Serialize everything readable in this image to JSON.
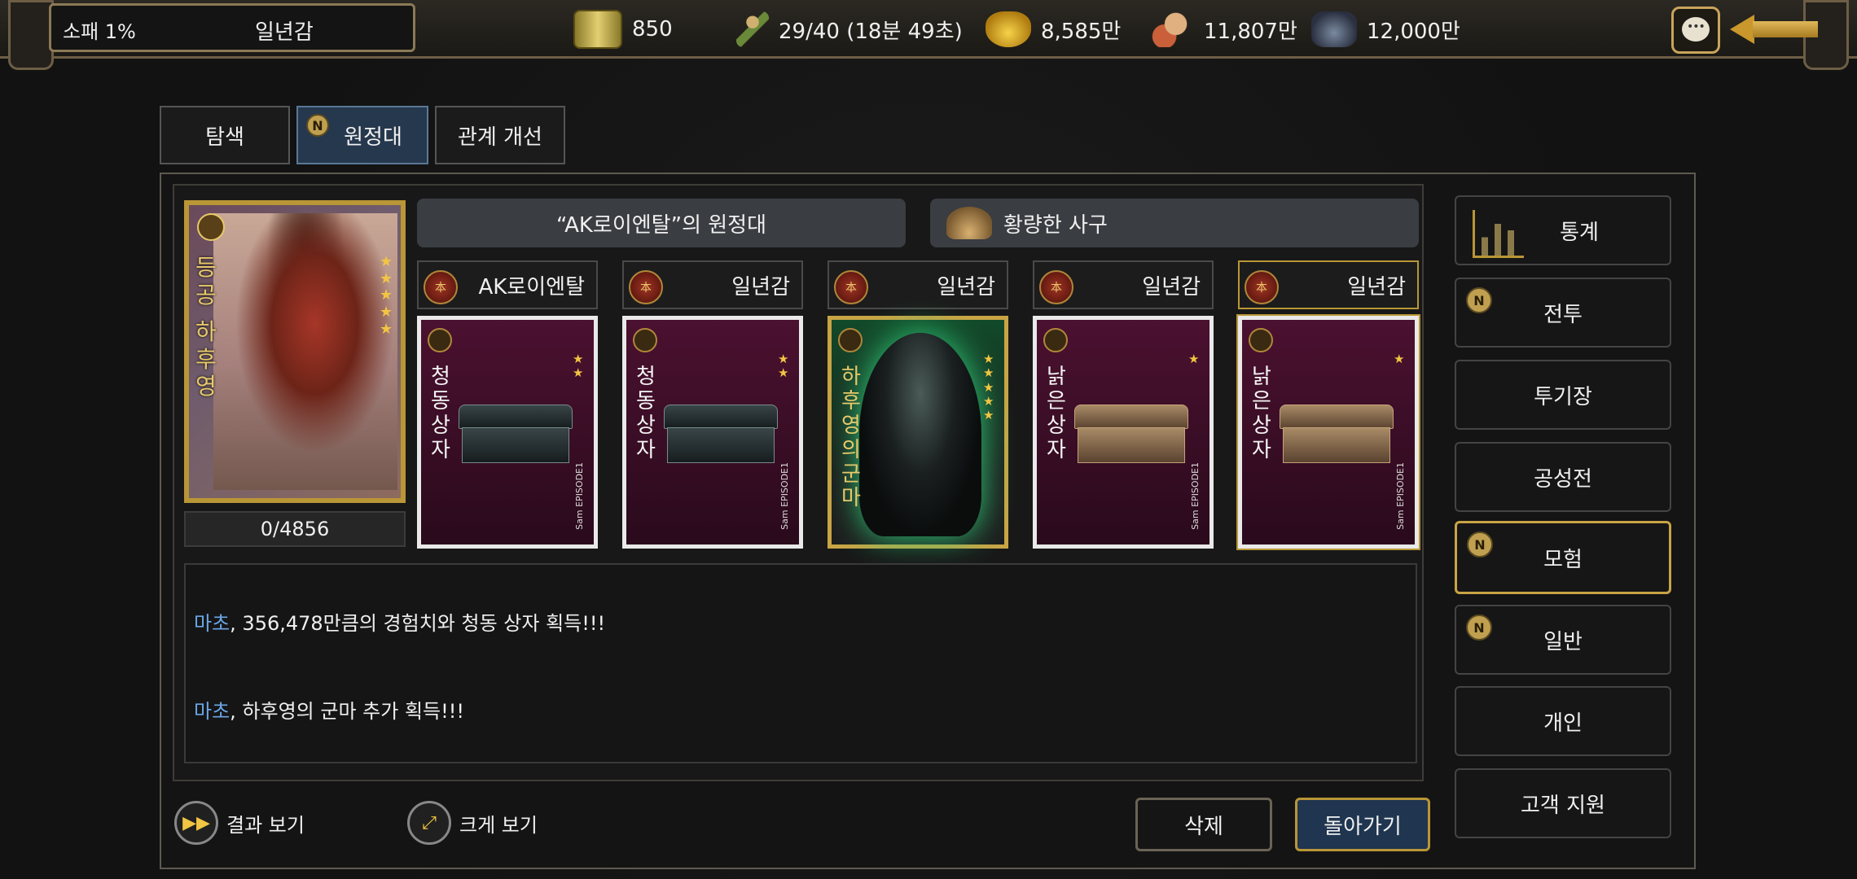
{
  "topbar": {
    "player_label": "소패 1%",
    "player_name": "일년감",
    "resources": [
      {
        "icon": "scroll-icon",
        "value": "850"
      },
      {
        "icon": "runner-stamina-icon",
        "value": "29/40 (18분 49초)"
      },
      {
        "icon": "gold-ingot-icon",
        "value": "8,585만"
      },
      {
        "icon": "food-meat-icon",
        "value": "11,807만"
      },
      {
        "icon": "iron-ore-icon",
        "value": "12,000만"
      }
    ]
  },
  "tabs": [
    {
      "label": "탐색",
      "badge": ""
    },
    {
      "label": "원정대",
      "badge": "N"
    },
    {
      "label": "관계 개선",
      "badge": ""
    }
  ],
  "hero": {
    "vertical_title": "등공",
    "vertical_name": "하후영",
    "stars": 5,
    "count": "0/4856"
  },
  "expedition": {
    "title": "“AK로이엔탈”의 원정대",
    "target_label": "황량한 사구"
  },
  "members": [
    {
      "name": "AK로이엔탈",
      "emblem": "本",
      "card": "청동 상자",
      "stars": 2,
      "type": "dark-chest",
      "episode": "Sam EPISODE1"
    },
    {
      "name": "일년감",
      "emblem": "本",
      "card": "청동 상자",
      "stars": 2,
      "type": "dark-chest",
      "episode": "Sam EPISODE1"
    },
    {
      "name": "일년감",
      "emblem": "本",
      "card": "하후영의 군마",
      "stars": 5,
      "type": "horse",
      "episode": ""
    },
    {
      "name": "일년감",
      "emblem": "本",
      "card": "낡은 상자",
      "stars": 1,
      "type": "wood-chest",
      "episode": "Sam EPISODE1"
    },
    {
      "name": "일년감",
      "emblem": "本",
      "card": "낡은 상자",
      "stars": 1,
      "type": "wood-chest",
      "episode": "Sam EPISODE1"
    }
  ],
  "log": [
    {
      "who": "마초",
      "text": ", 356,478만큼의 경험치와  청동 상자 획득!!!"
    },
    {
      "who": "마초",
      "text": ", 하후영의 군마 추가 획득!!!"
    }
  ],
  "bottom": {
    "result_label": "결과 보기",
    "zoom_label": "크게 보기",
    "delete_label": "삭제",
    "back_label": "돌아가기"
  },
  "sidebar": [
    {
      "label": "통계",
      "badge": "",
      "icon": "chart-icon"
    },
    {
      "label": "전투",
      "badge": "N"
    },
    {
      "label": "투기장",
      "badge": ""
    },
    {
      "label": "공성전",
      "badge": ""
    },
    {
      "label": "모험",
      "badge": "N",
      "active": true
    },
    {
      "label": "일반",
      "badge": "N"
    },
    {
      "label": "개인",
      "badge": ""
    },
    {
      "label": "고객 지원",
      "badge": ""
    }
  ],
  "colors": {
    "accent_gold": "#c9a445",
    "player_blue": "#6aa6e8",
    "tab_active": "#26384d"
  }
}
